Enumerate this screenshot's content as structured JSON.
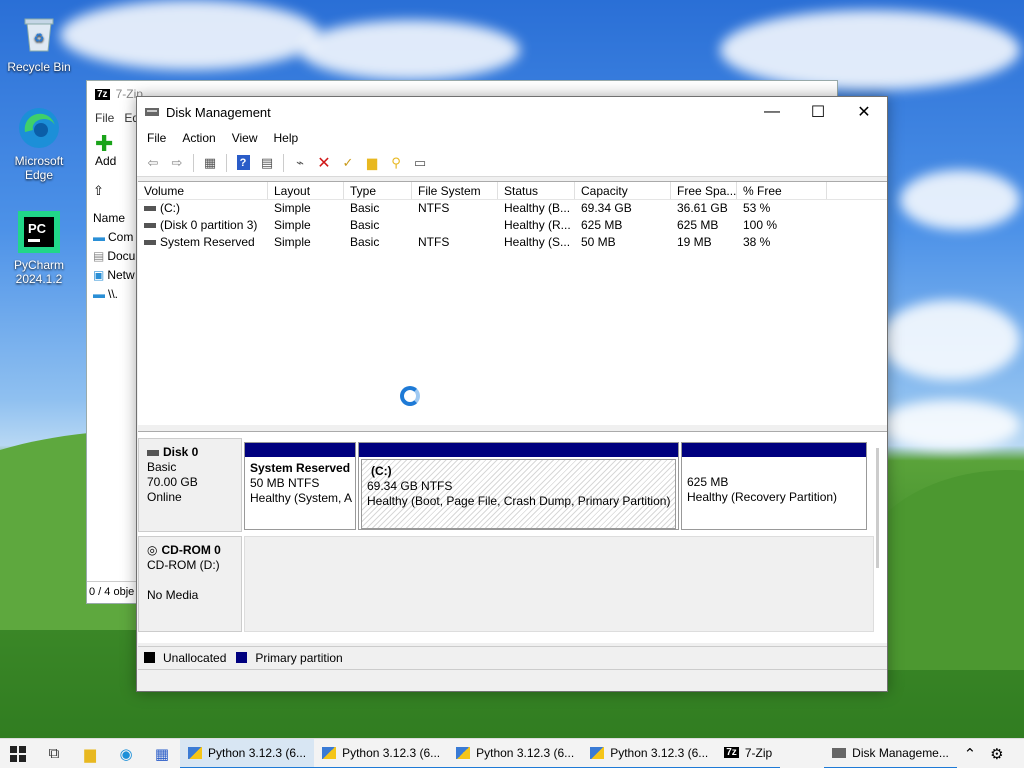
{
  "desktop": {
    "icons": [
      {
        "label": "Recycle Bin",
        "icon": "recycle-bin-icon"
      },
      {
        "label": "Microsoft Edge",
        "icon": "edge-icon"
      },
      {
        "label": "PyCharm 2024.1.2",
        "icon": "pycharm-icon"
      }
    ]
  },
  "zip_window": {
    "title": "7-Zip",
    "menu": [
      "File",
      "Ed"
    ],
    "add_label": "Add",
    "col_name": "Name",
    "sidebar": [
      "Com",
      "Docu",
      "Netw",
      "\\\\."
    ],
    "status": "0 / 4 obje"
  },
  "disk_mgmt": {
    "title": "Disk Management",
    "menu": [
      "File",
      "Action",
      "View",
      "Help"
    ],
    "columns": [
      "Volume",
      "Layout",
      "Type",
      "File System",
      "Status",
      "Capacity",
      "Free Spa...",
      "% Free"
    ],
    "rows": [
      [
        "(C:)",
        "Simple",
        "Basic",
        "NTFS",
        "Healthy (B...",
        "69.34 GB",
        "36.61 GB",
        "53 %"
      ],
      [
        "(Disk 0 partition 3)",
        "Simple",
        "Basic",
        "",
        "Healthy (R...",
        "625 MB",
        "625 MB",
        "100 %"
      ],
      [
        "System Reserved",
        "Simple",
        "Basic",
        "NTFS",
        "Healthy (S...",
        "50 MB",
        "19 MB",
        "38 %"
      ]
    ],
    "disk0": {
      "name": "Disk 0",
      "type": "Basic",
      "size": "70.00 GB",
      "state": "Online",
      "partitions": [
        {
          "title": "System Reserved",
          "line1": "50 MB NTFS",
          "line2": "Healthy (System, A"
        },
        {
          "title": "(C:)",
          "line1": "69.34 GB NTFS",
          "line2": "Healthy (Boot, Page File, Crash Dump, Primary Partition)"
        },
        {
          "title": "",
          "line1": "625 MB",
          "line2": "Healthy (Recovery Partition)"
        }
      ]
    },
    "cdrom": {
      "name": "CD-ROM 0",
      "drive": "CD-ROM (D:)",
      "media": "No Media"
    },
    "legend": {
      "unallocated": "Unallocated",
      "primary": "Primary partition",
      "unallocated_color": "#000000",
      "primary_color": "#00007f"
    }
  },
  "taskbar": {
    "tasks": [
      {
        "label": "Python 3.12.3 (6...",
        "icon": "python-icon",
        "state": "active"
      },
      {
        "label": "Python 3.12.3 (6...",
        "icon": "python-icon",
        "state": "open"
      },
      {
        "label": "Python 3.12.3 (6...",
        "icon": "python-icon",
        "state": "open"
      },
      {
        "label": "Python 3.12.3 (6...",
        "icon": "python-icon",
        "state": "open"
      },
      {
        "label": "7-Zip",
        "icon": "7zip-icon",
        "state": "open"
      },
      {
        "label": "Disk Manageme...",
        "icon": "disk-management-icon",
        "state": "open"
      }
    ]
  }
}
